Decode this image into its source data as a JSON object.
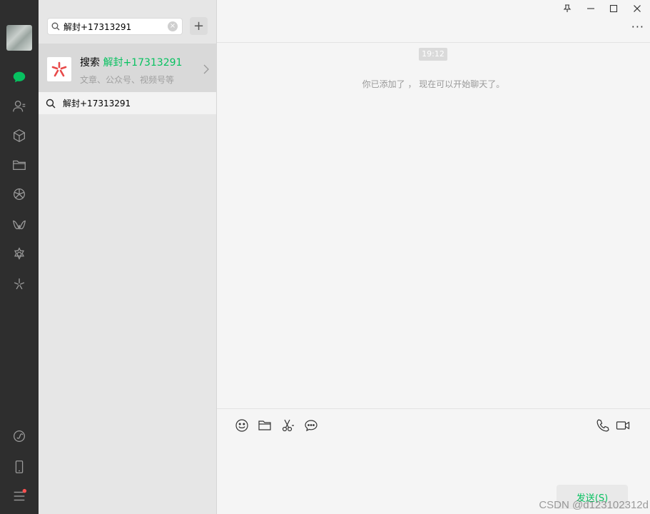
{
  "search": {
    "query": "解封+17313291",
    "add_label": "+"
  },
  "result": {
    "prefix": "搜索",
    "keyword": "解封+17313291",
    "subtitle": "文章、公众号、视频号等"
  },
  "suggestion": {
    "text": "解封+17313291"
  },
  "chat": {
    "time": "19:12",
    "system_message": "你已添加了 ， 现在可以开始聊天了。",
    "more": "···",
    "send_label": "发送(S)"
  },
  "watermark": "CSDN @d123102312d",
  "colors": {
    "accent": "#07c160",
    "nav_bg": "#2e2e2e",
    "badge": "#fa5151",
    "logo": "#e84a4a"
  },
  "icons": {
    "nav": [
      "chat-icon",
      "contacts-icon",
      "cube-icon",
      "folder-icon",
      "moments-icon",
      "channels-icon",
      "gear-flower-icon",
      "search-star-icon",
      "miniprogram-icon",
      "phone-icon",
      "menu-icon"
    ],
    "toolbar": [
      "emoji-icon",
      "file-icon",
      "scissors-icon",
      "chat-history-icon",
      "voice-call-icon",
      "video-call-icon"
    ],
    "window": [
      "pin-icon",
      "minimize-icon",
      "maximize-icon",
      "close-icon"
    ]
  }
}
